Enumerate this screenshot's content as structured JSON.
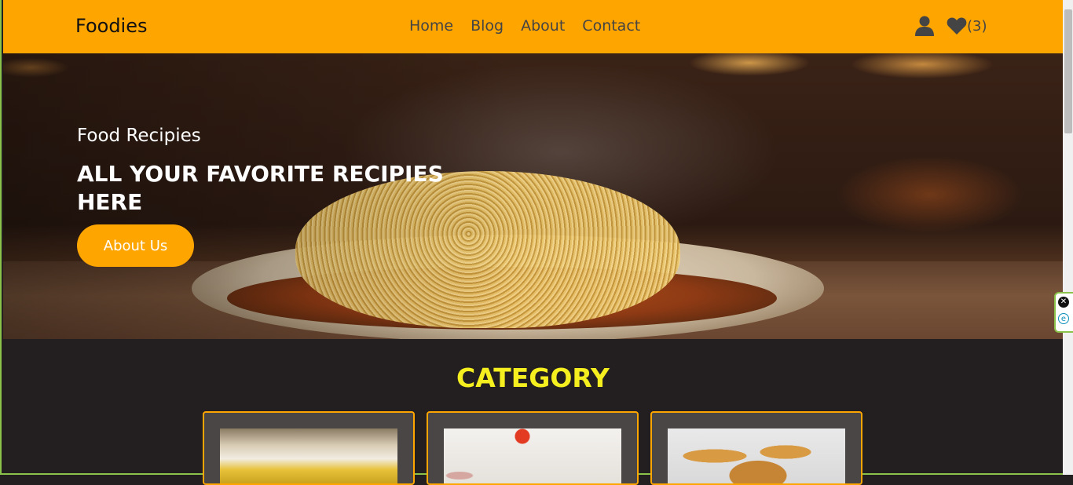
{
  "navbar": {
    "brand": "Foodies",
    "links": [
      "Home",
      "Blog",
      "About",
      "Contact"
    ],
    "favorites_count": "(3)",
    "icons": [
      "user-icon",
      "heart-icon"
    ]
  },
  "hero": {
    "eyebrow": "Food Recipies",
    "title": "ALL YOUR FAVORITE RECIPIES HERE",
    "button_label": "About Us"
  },
  "category": {
    "title": "CATEGORY",
    "cards": [
      "rice-dish-image",
      "ingredients-image",
      "burgers-image"
    ]
  },
  "side_widget": {
    "icons": [
      "close-icon",
      "e-icon"
    ],
    "close_glyph": "✕",
    "e_glyph": "e"
  },
  "colors": {
    "accent": "#ffa500",
    "category_title": "#f5ef1f",
    "background": "#231f20"
  }
}
